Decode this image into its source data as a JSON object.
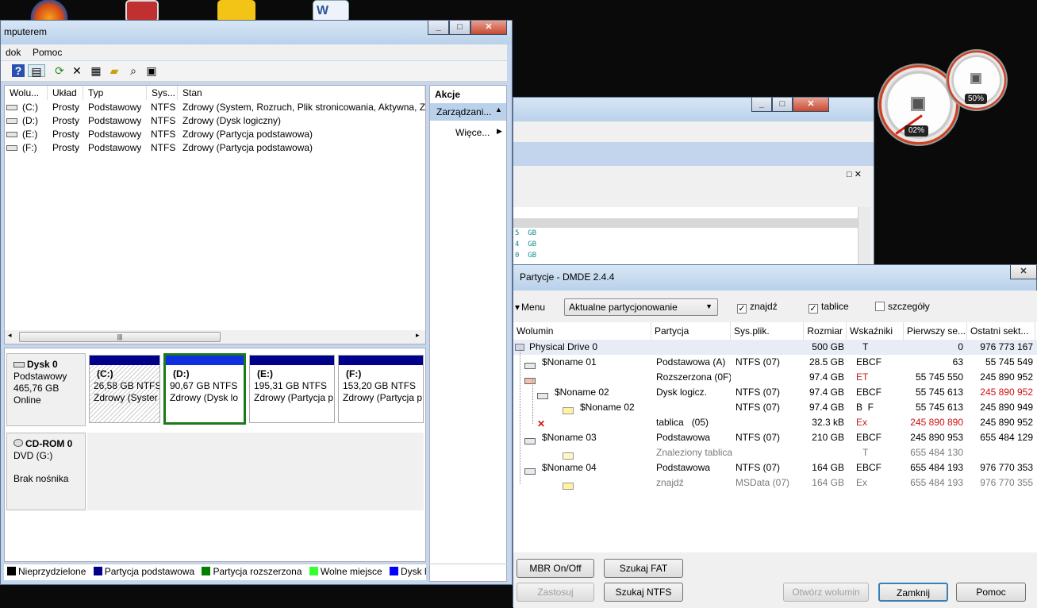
{
  "desktop": {
    "gadget": {
      "cpu_percent": "02%",
      "mem_percent": "50%"
    }
  },
  "disk_mgmt": {
    "title": "mputerem",
    "menu": [
      "dok",
      "Pomoc"
    ],
    "columns": [
      "Wolu...",
      "Układ",
      "Typ",
      "Sys...",
      "Stan"
    ],
    "volumes": [
      {
        "name": "(C:)",
        "layout": "Prosty",
        "type": "Podstawowy",
        "fs": "NTFS",
        "status": "Zdrowy (System, Rozruch, Plik stronicowania, Aktywna, Zr"
      },
      {
        "name": "(D:)",
        "layout": "Prosty",
        "type": "Podstawowy",
        "fs": "NTFS",
        "status": "Zdrowy (Dysk logiczny)"
      },
      {
        "name": "(E:)",
        "layout": "Prosty",
        "type": "Podstawowy",
        "fs": "NTFS",
        "status": "Zdrowy (Partycja podstawowa)"
      },
      {
        "name": "(F:)",
        "layout": "Prosty",
        "type": "Podstawowy",
        "fs": "NTFS",
        "status": "Zdrowy (Partycja podstawowa)"
      }
    ],
    "actions": {
      "header": "Akcje",
      "item": "Zarządzani...",
      "more": "Więce..."
    },
    "disk0": {
      "name": "Dysk 0",
      "type": "Podstawowy",
      "size": "465,76 GB",
      "state": "Online",
      "partitions": [
        {
          "label": "(C:)",
          "size": "26,58 GB NTFS",
          "status": "Zdrowy (Syster"
        },
        {
          "label": "(D:)",
          "size": "90,67 GB NTFS",
          "status": "Zdrowy (Dysk lo"
        },
        {
          "label": "(E:)",
          "size": "195,31 GB NTFS",
          "status": "Zdrowy (Partycja p"
        },
        {
          "label": "(F:)",
          "size": "153,20 GB NTFS",
          "status": "Zdrowy (Partycja p"
        }
      ]
    },
    "cdrom": {
      "name": "CD-ROM 0",
      "drive": "DVD (G:)",
      "state": "Brak nośnika"
    },
    "legend": [
      {
        "label": "Nieprzydzielone",
        "color": "#000000"
      },
      {
        "label": "Partycja podstawowa",
        "color": "#00008b"
      },
      {
        "label": "Partycja rozszerzona",
        "color": "#008000"
      },
      {
        "label": "Wolne miejsce",
        "color": "#33ff33"
      },
      {
        "label": "Dysk log",
        "color": "#0000ff"
      }
    ]
  },
  "mid_window": {
    "lines": [
      "5  GB",
      "4  GB",
      "0  GB"
    ]
  },
  "dmde": {
    "title": "Partycje - DMDE 2.4.4",
    "menu_label": "Menu",
    "dropdown_value": "Aktualne partycjonowanie",
    "checks": [
      {
        "label": "znajdź",
        "checked": true
      },
      {
        "label": "tablice",
        "checked": true
      },
      {
        "label": "szczegóły",
        "checked": false
      }
    ],
    "columns": [
      "Wolumin",
      "Partycja",
      "Sys.plik.",
      "Rozmiar",
      "Wskaźniki",
      "Pierwszy se...",
      "Ostatni sekt..."
    ],
    "rows": [
      {
        "name": "Physical Drive 0",
        "part": "",
        "fs": "",
        "size": "500 GB",
        "flags": "T",
        "first": "0",
        "last": "976 773 167",
        "grey": false,
        "first_red": false,
        "last_red": false
      },
      {
        "name": "$Noname 01",
        "part": "Podstawowa (A)",
        "fs": "NTFS (07)",
        "size": "28.5 GB",
        "flags": "EBCF",
        "first": "63",
        "last": "55 745 549",
        "grey": false,
        "first_red": false,
        "last_red": false
      },
      {
        "name": "",
        "part": "Rozszerzona  (0F)",
        "fs": "",
        "size": "97.4 GB",
        "flags": "ET",
        "first": "55 745 550",
        "last": "245 890 952",
        "grey": false,
        "first_red": false,
        "last_red": false
      },
      {
        "name": "$Noname 02",
        "part": "Dysk logicz.",
        "fs": "NTFS (07)",
        "size": "97.4 GB",
        "flags": "EBCF",
        "first": "55 745 613",
        "last": "245 890 952",
        "grey": false,
        "first_red": false,
        "last_red": true
      },
      {
        "name": "$Noname 02",
        "part": "",
        "fs": "NTFS (07)",
        "size": "97.4 GB",
        "flags": "B  F",
        "first": "55 745 613",
        "last": "245 890 949",
        "grey": false,
        "first_red": false,
        "last_red": false
      },
      {
        "name": "",
        "part": "tablica   (05)",
        "fs": "",
        "size": "32.3 kB",
        "flags": "Ex",
        "first": "245 890 890",
        "last": "245 890 952",
        "grey": false,
        "first_red": true,
        "last_red": false
      },
      {
        "name": "$Noname 03",
        "part": "Podstawowa",
        "fs": "NTFS (07)",
        "size": "210 GB",
        "flags": "EBCF",
        "first": "245 890 953",
        "last": "655 484 129",
        "grey": false,
        "first_red": false,
        "last_red": false
      },
      {
        "name": "",
        "part": "Znaleziony tablica",
        "fs": "",
        "size": "",
        "flags": "T",
        "first": "655 484 130",
        "last": "",
        "grey": true,
        "first_red": false,
        "last_red": false
      },
      {
        "name": "$Noname 04",
        "part": "Podstawowa",
        "fs": "NTFS (07)",
        "size": "164 GB",
        "flags": "EBCF",
        "first": "655 484 193",
        "last": "976 770 353",
        "grey": false,
        "first_red": false,
        "last_red": false
      },
      {
        "name": "",
        "part": "znajdź",
        "fs": "MSData (07)",
        "size": "164 GB",
        "flags": "Ex",
        "first": "655 484 193",
        "last": "976 770 355",
        "grey": true,
        "first_red": false,
        "last_red": false
      }
    ],
    "buttons": {
      "mbr": "MBR On/Off",
      "fat": "Szukaj FAT",
      "apply": "Zastosuj",
      "ntfs": "Szukaj NTFS",
      "open": "Otwórz wolumin",
      "close": "Zamknij",
      "help": "Pomoc"
    }
  }
}
